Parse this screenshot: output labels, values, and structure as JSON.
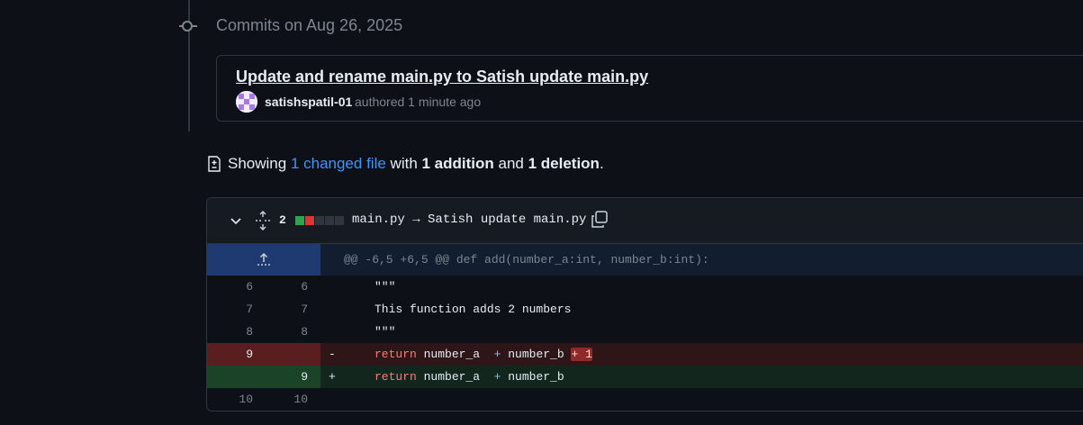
{
  "timeline": {
    "date_heading": "Commits on Aug 26, 2025"
  },
  "commit": {
    "title": "Update and rename main.py to Satish update main.py",
    "author": "satishspatil-01",
    "meta": "authored 1 minute ago"
  },
  "summary": {
    "showing": "Showing ",
    "changed_link": "1 changed file",
    "with": " with ",
    "additions": "1 addition",
    "and": " and ",
    "deletions": "1 deletion",
    "period": "."
  },
  "file": {
    "change_count": "2",
    "diffstat": [
      "#2da44e",
      "#da3633",
      "#30363d",
      "#30363d",
      "#30363d"
    ],
    "name": "main.py → Satish update main.py"
  },
  "diff": {
    "hunk_header": "@@ -6,5 +6,5 @@ def add(number_a:int, number_b:int):",
    "lines": [
      {
        "old": "6",
        "new": "6",
        "sign": "",
        "code": "\"\"\""
      },
      {
        "old": "7",
        "new": "7",
        "sign": "",
        "code": "This function adds 2 numbers"
      },
      {
        "old": "8",
        "new": "8",
        "sign": "",
        "code": "\"\"\""
      },
      {
        "old": "9",
        "new": "",
        "sign": "-",
        "kw": "return",
        "text": " number_a  ",
        "op": "+",
        "text2": " number_b ",
        "removed": "+ 1"
      },
      {
        "old": "",
        "new": "9",
        "sign": "+",
        "kw": "return",
        "text": " number_a  ",
        "op": "+",
        "text2": " number_b"
      },
      {
        "old": "10",
        "new": "10",
        "sign": "",
        "code": ""
      }
    ]
  },
  "colors": {
    "accent_link": "#4493f8",
    "addition": "#2da44e",
    "deletion": "#da3633",
    "background": "#0d1117"
  }
}
